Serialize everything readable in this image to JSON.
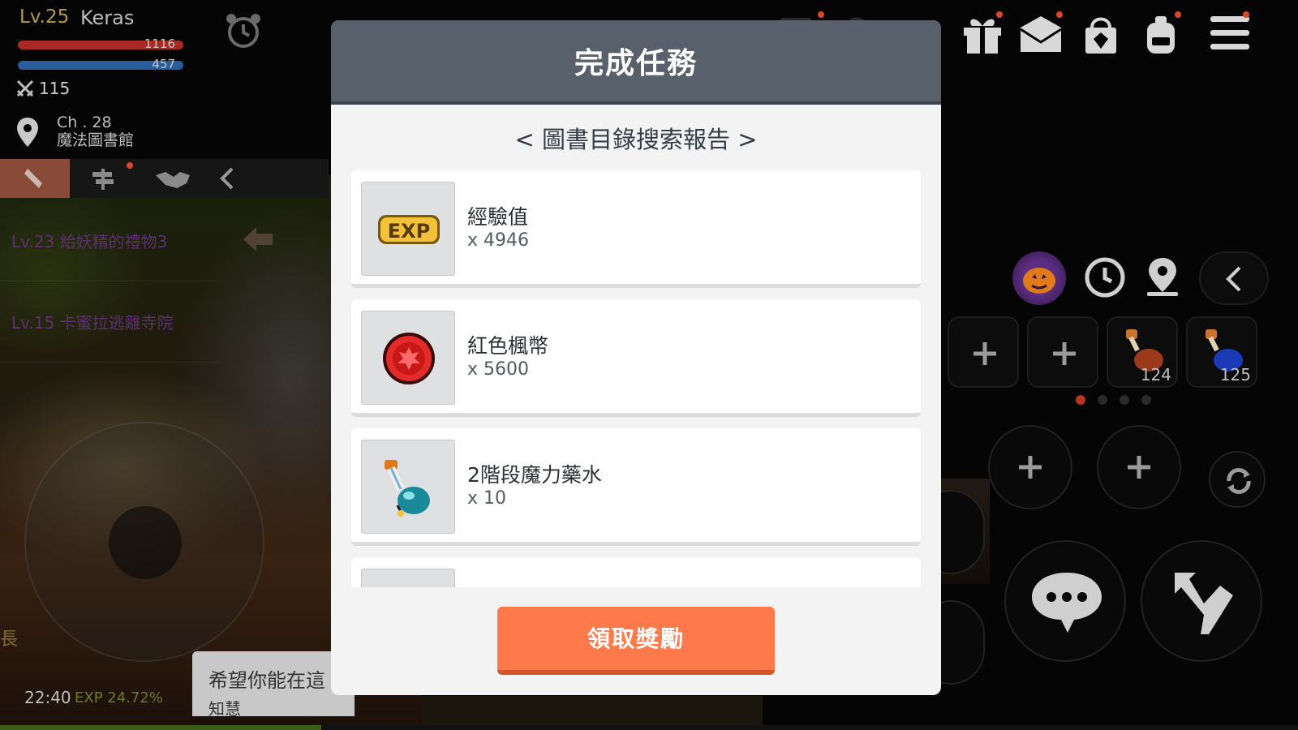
{
  "modal": {
    "title": "完成任務",
    "quest_name": "< 圖書目錄搜索報告 >",
    "rewards": [
      {
        "name": "經驗值",
        "qty": "x 4946",
        "icon": "exp-icon"
      },
      {
        "name": "紅色楓幣",
        "qty": "x 5600",
        "icon": "red-maple-coin-icon"
      },
      {
        "name": "2階段魔力藥水",
        "qty": "x 10",
        "icon": "mana-potion-icon"
      }
    ],
    "claim_label": "領取獎勵"
  },
  "player": {
    "level": "Lv.25",
    "name": "Keras",
    "hp": "1116",
    "mp": "457",
    "attack": "115",
    "channel": "Ch . 28",
    "map": "魔法圖書館",
    "hp_color": "#a82a26",
    "mp_color": "#2a5e9a"
  },
  "quests": [
    {
      "label": "Lv.23  給妖精的禮物3"
    },
    {
      "label": "Lv.15  卡蜜拉逃離寺院"
    }
  ],
  "chat": {
    "line1": "希望你能在這",
    "line2": "知慧"
  },
  "status": {
    "time": "22:40",
    "exp": "EXP 24.72%",
    "exp_fraction": 0.2472,
    "side_char": "長"
  },
  "quickslots": [
    {
      "count": ""
    },
    {
      "count": ""
    },
    {
      "count": "124"
    },
    {
      "count": "125"
    }
  ],
  "colors": {
    "accent_button": "#ff7a4b",
    "modal_header": "#58606c",
    "notification_dot": "#e0452a"
  }
}
